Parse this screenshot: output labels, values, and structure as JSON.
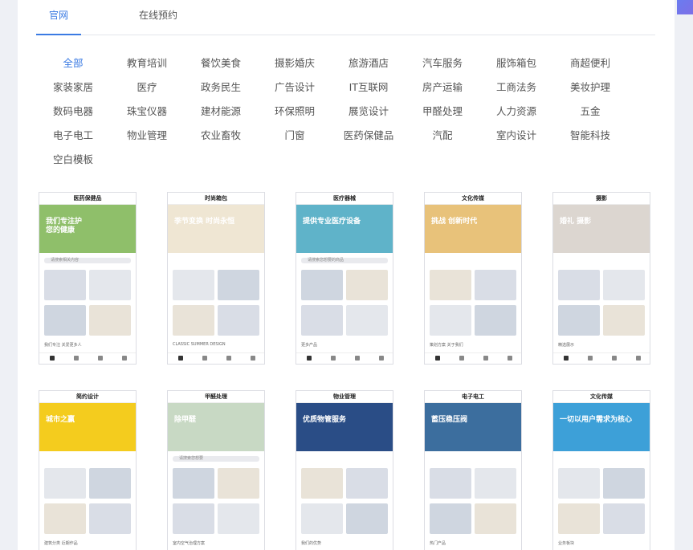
{
  "tabs": [
    {
      "label": "官网",
      "active": true
    },
    {
      "label": "在线预约",
      "active": false
    }
  ],
  "categories": [
    "全部",
    "教育培训",
    "餐饮美食",
    "摄影婚庆",
    "旅游酒店",
    "汽车服务",
    "服饰箱包",
    "商超便利",
    "家装家居",
    "医疗",
    "政务民生",
    "广告设计",
    "IT互联网",
    "房产运输",
    "工商法务",
    "美妆护理",
    "数码电器",
    "珠宝仪器",
    "建材能源",
    "环保照明",
    "展览设计",
    "甲醛处理",
    "人力资源",
    "五金",
    "电子电工",
    "物业管理",
    "农业畜牧",
    "门窗",
    "医药保健品",
    "汽配",
    "室内设计",
    "智能科技",
    "空白模板"
  ],
  "active_category": "全部",
  "accent_color": "#3b7be3",
  "templates": [
    {
      "title": "医药保健品",
      "hero": "我们专注护\n您的健康",
      "hero_color": "#8fbf6a",
      "search": "请搜索相关内容",
      "section": "我们专注 关爱更多人"
    },
    {
      "title": "时尚箱包",
      "hero": "季节变换 时尚永恒",
      "hero_color": "#efe6d3",
      "search": "",
      "section": "CLASSIC SUMMER DESIGN"
    },
    {
      "title": "医疗器械",
      "hero": "提供专业医疗设备",
      "hero_color": "#5fb3c9",
      "search": "请搜索您想要的商品",
      "section": "更多产品"
    },
    {
      "title": "文化传媒",
      "hero": "挑战 创新时代",
      "hero_color": "#e8c27a",
      "search": "",
      "section": "策划方案 关于我们"
    },
    {
      "title": "摄影",
      "hero": "婚礼 摄影",
      "hero_color": "#dcd6d0",
      "search": "",
      "section": "精选展示"
    },
    {
      "title": "简约设计",
      "hero": "城市之赢",
      "hero_color": "#f4cc1e",
      "search": "",
      "section": "建筑分类 近期作品"
    },
    {
      "title": "甲醛处理",
      "hero": "除甲醛",
      "hero_color": "#c8d9c4",
      "search": "请搜索您想要",
      "section": "室内空气治理方案"
    },
    {
      "title": "物业管理",
      "hero": "优质物管服务",
      "hero_color": "#2a4d86",
      "search": "",
      "section": "我们的优势"
    },
    {
      "title": "电子电工",
      "hero": "蓄压稳压阀",
      "hero_color": "#3c6e9e",
      "search": "",
      "section": "热门产品"
    },
    {
      "title": "文化传媒",
      "hero": "一切以用户需求为核心",
      "hero_color": "#3da0d8",
      "search": "",
      "section": "业务板块"
    }
  ]
}
